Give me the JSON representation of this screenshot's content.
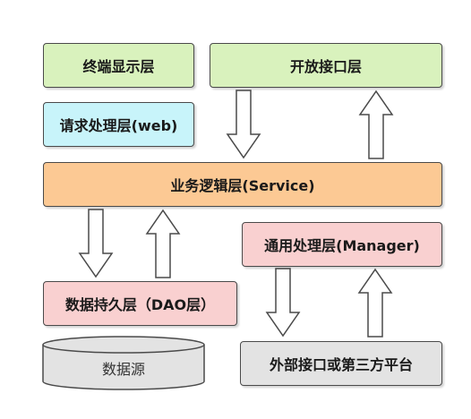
{
  "colors": {
    "green": "#d9f2bd",
    "cyan": "#c8f4fa",
    "orange": "#fcc994",
    "pink": "#f9d0d0",
    "gray": "#e3e3e3",
    "border": "#4a4a4a"
  },
  "boxes": {
    "terminal": "终端显示层",
    "openapi": "开放接口层",
    "request": "请求处理层(web)",
    "service": "业务逻辑层(Service)",
    "manager": "通用处理层(Manager)",
    "dao": "数据持久层（DAO层）",
    "external": "外部接口或第三方平台"
  },
  "database": {
    "label": "数据源"
  }
}
